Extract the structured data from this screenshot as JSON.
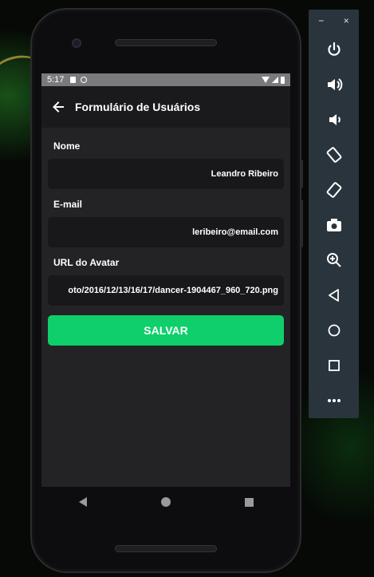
{
  "status_bar": {
    "time": "5:17"
  },
  "app_bar": {
    "title": "Formulário de Usuários"
  },
  "form": {
    "name_label": "Nome",
    "name_value": "Leandro Ribeiro",
    "email_label": "E-mail",
    "email_value": "leribeiro@email.com",
    "avatar_label": "URL do Avatar",
    "avatar_value": "oto/2016/12/13/16/17/dancer-1904467_960_720.png",
    "save_label": "SALVAR"
  },
  "emulator": {
    "minimize": "−",
    "close": "×"
  },
  "colors": {
    "accent": "#0fcf6c",
    "screen_bg": "#232325",
    "input_bg": "#18181a",
    "sidebar_bg": "#2a343c"
  }
}
